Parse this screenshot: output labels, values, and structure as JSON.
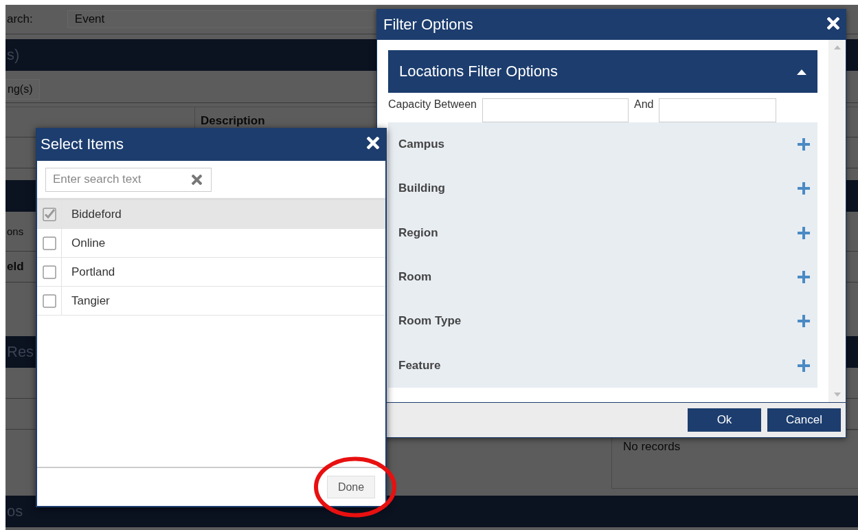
{
  "background": {
    "search_label": "arch:",
    "search_value": "Event",
    "section_1": "s)",
    "button": "ng(s)",
    "column_header": "Description",
    "text_1": "ons",
    "text_2": "eld",
    "section_2": "Res",
    "empty_message": "No records",
    "section_3": "os"
  },
  "filter_dialog": {
    "title": "Filter Options",
    "section": {
      "title": "Locations Filter Options",
      "expanded": true
    },
    "capacity_label": "Capacity Between",
    "and_label": "And",
    "groups": [
      {
        "label": "Campus",
        "expanded": false
      },
      {
        "label": "Building",
        "expanded": false
      },
      {
        "label": "Region",
        "expanded": false
      },
      {
        "label": "Room",
        "expanded": false
      },
      {
        "label": "Room Type",
        "expanded": false
      },
      {
        "label": "Feature",
        "expanded": false
      }
    ],
    "buttons": [
      "Ok",
      "Cancel"
    ]
  },
  "select_dialog": {
    "title": "Select Items",
    "search": {
      "placeholder": "Enter search text"
    },
    "items": [
      {
        "label": "Biddeford",
        "checked": true
      },
      {
        "label": "Online",
        "checked": false
      },
      {
        "label": "Portland",
        "checked": false
      },
      {
        "label": "Tangier",
        "checked": false
      }
    ],
    "done": "Done"
  }
}
